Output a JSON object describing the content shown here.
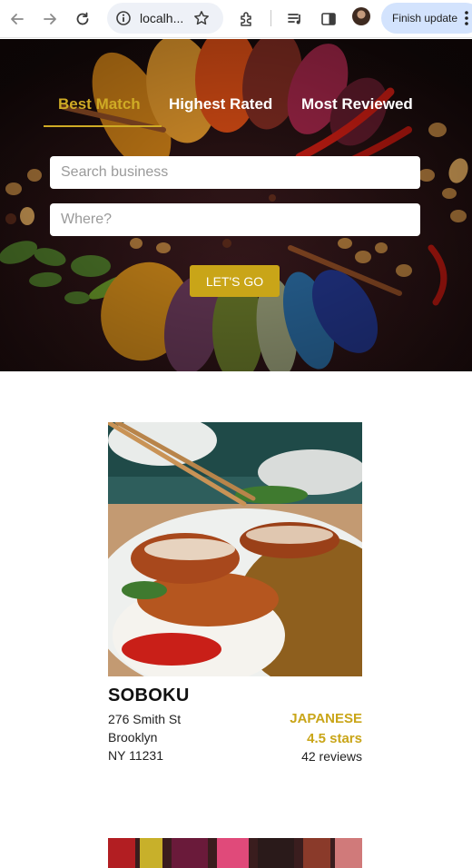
{
  "browser": {
    "url_text": "localh...",
    "update_label": "Finish update"
  },
  "hero": {
    "tabs": [
      {
        "label": "Best Match",
        "active": true
      },
      {
        "label": "Highest Rated",
        "active": false
      },
      {
        "label": "Most Reviewed",
        "active": false
      }
    ],
    "search_placeholder": "Search business",
    "location_placeholder": "Where?",
    "submit_label": "LET'S GO"
  },
  "results": [
    {
      "name": "SOBOKU",
      "address_line1": "276 Smith St",
      "address_line2": "Brooklyn",
      "address_line3": "NY 11231",
      "category": "JAPANESE",
      "rating": "4.5 stars",
      "review_count": "42 reviews"
    }
  ],
  "colors": {
    "accent": "#c9a518",
    "active_tab": "#cfab25",
    "update_pill": "#d3e3fd"
  }
}
